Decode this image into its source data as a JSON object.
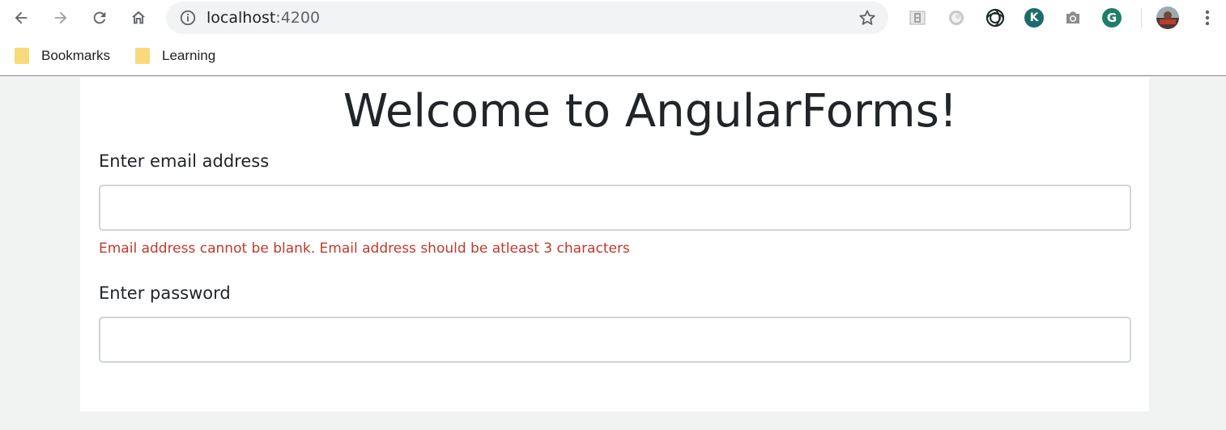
{
  "browser": {
    "url_host": "localhost",
    "url_port": ":4200",
    "nav_icons": [
      "back-arrow-icon",
      "forward-arrow-icon",
      "reload-icon",
      "home-icon"
    ],
    "bookmarks": [
      {
        "label": "Bookmarks",
        "icon": "folder-icon"
      },
      {
        "label": "Learning",
        "icon": "folder-icon"
      }
    ],
    "extensions": [
      "reader-extension-icon",
      "circle-extension-icon",
      "spiral-extension-icon",
      "k-extension-icon",
      "camera-extension-icon",
      "grammarly-extension-icon"
    ],
    "extension_letters": {
      "k": "K",
      "g": "G"
    },
    "colors": {
      "accent_teal": "#1f7d7d",
      "folder": "#f9d97a"
    }
  },
  "page": {
    "title": "Welcome to AngularForms!",
    "email": {
      "label": "Enter email address",
      "value": "",
      "error": "Email address cannot be blank. Email address should be atleast 3 characters"
    },
    "password": {
      "label": "Enter password",
      "value": ""
    },
    "colors": {
      "error": "#c0392b",
      "text": "#212529",
      "border": "#ced4da"
    }
  }
}
